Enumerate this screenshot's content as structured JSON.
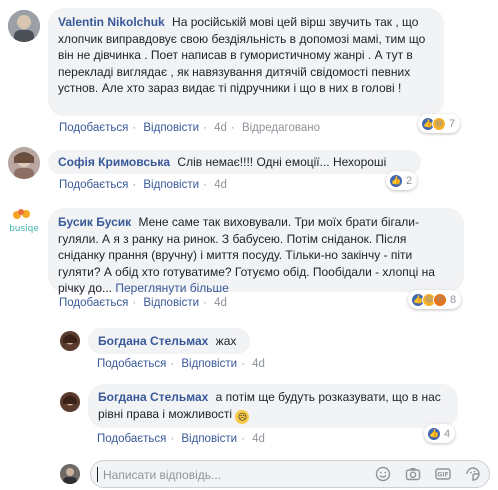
{
  "comments": [
    {
      "author": "Valentin Nikolchuk",
      "text": "На російській мові цей вірш звучить так , що хлопчик виправдовує свою бездіяльність в допомозі мамі, тим що він не дівчинка . Поет написав в гумористичному жанрі . А тут в перекладі виглядає , як навязування дитячій свідомості певних устнов. Але хто зараз видає ті підручники і що в них в голові !",
      "like": "Подобається",
      "reply": "Відповісти",
      "time": "4d",
      "edited": "Відредаговано",
      "reaction_count": "7"
    },
    {
      "author": "Софія Кримовська",
      "text": "Слів немає!!!! Одні емоції... Нехороші",
      "like": "Подобається",
      "reply": "Відповісти",
      "time": "4d",
      "reaction_count": "2"
    },
    {
      "author": "Бусик Бусик",
      "text": "Мене саме так виховували. Три моїх брати бігали-гуляли. А я з ранку на ринок. З бабусею. Потім сніданок. Після сніданку прання (вручну) і миття посуду. Тільки-но закінчу - піти гуляти? А обід хто готуватиме? Готуємо обід. Пообідали - хлопці на річку до...",
      "see_more": "Переглянути більше",
      "like": "Подобається",
      "reply": "Відповісти",
      "time": "4d",
      "reaction_count": "8",
      "avatar_text": "busiqe"
    }
  ],
  "replies": [
    {
      "author": "Богдана Стельмах",
      "text": "жах",
      "like": "Подобається",
      "reply": "Відповісти",
      "time": "4d"
    },
    {
      "author": "Богдана Стельмах",
      "text": "а потім ще будуть розказувати, що в нас рівні права і можливості",
      "like": "Подобається",
      "reply": "Відповісти",
      "time": "4d",
      "reaction_count": "4"
    }
  ],
  "composer": {
    "placeholder": "Написати відповідь..."
  },
  "colors": {
    "link": "#385898",
    "bubble": "#f2f3f5",
    "meta": "#90949c",
    "like": "#4267b2"
  }
}
